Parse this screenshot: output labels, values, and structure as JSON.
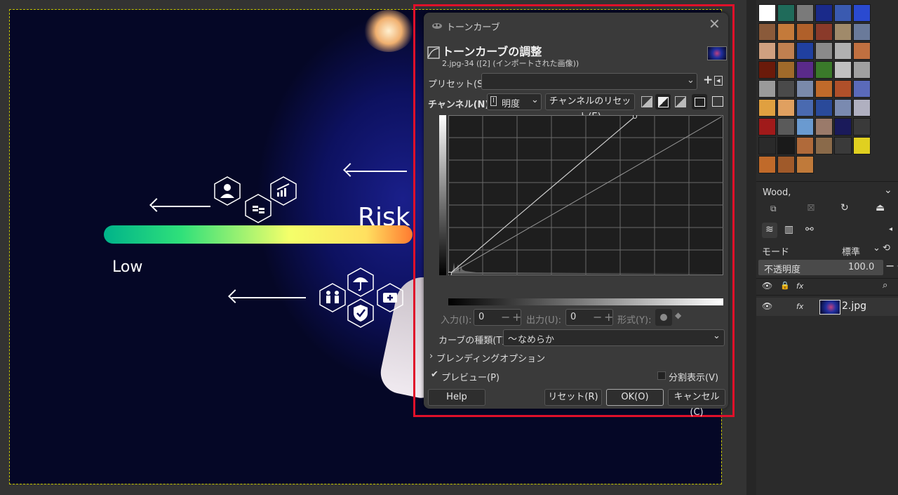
{
  "image": {
    "risk_label": "Risk",
    "low_label": "Low"
  },
  "dialog": {
    "window_title": "トーンカーブ",
    "heading": "トーンカーブの調整",
    "subheading": "2.jpg-34 ([2] (インポートされた画像))",
    "preset_label": "プリセット(S):",
    "preset_value": "",
    "channel_label": "チャンネル(N):",
    "channel_value": "明度",
    "channel_reset_label": "チャンネルのリセット(E)",
    "input_label": "入力(I):",
    "input_value": "0",
    "output_label": "出力(U):",
    "output_value": "0",
    "format_label": "形式(Y):",
    "curve_type_label": "カーブの種類(T)",
    "curve_type_value": "なめらか",
    "blending_label": "ブレンディングオプション",
    "preview_label": "プレビュー(P)",
    "preview_checked": true,
    "split_label": "分割表示(V)",
    "split_checked": false,
    "help_label": "Help",
    "reset_label": "リセット(R)",
    "ok_label": "OK(O)",
    "cancel_label": "キャンセル(C)"
  },
  "patterns": {
    "selected_name": "Wood,"
  },
  "layers": {
    "mode_label": "モード",
    "mode_value": "標準",
    "opacity_label": "不透明度",
    "opacity_value": "100.0",
    "layer_name": "2.jpg"
  },
  "colors": {
    "accent_red": "#e0102a",
    "dialog_bg": "#3a3a3a",
    "panel_bg": "#2b2b2b"
  }
}
